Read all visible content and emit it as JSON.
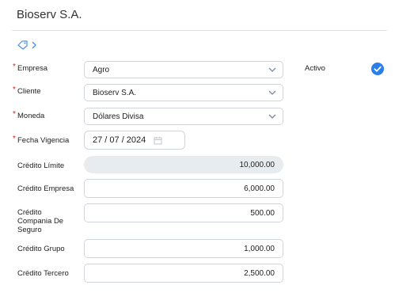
{
  "header": {
    "title": "Bioserv S.A."
  },
  "form": {
    "empresa": {
      "label": "Empresa",
      "value": "Agro"
    },
    "cliente": {
      "label": "Cliente",
      "value": "Bioserv S.A."
    },
    "moneda": {
      "label": "Moneda",
      "value": "Dólares Divisa"
    },
    "fecha": {
      "label": "Fecha Vigencia",
      "value": "27 / 07 / 2024"
    },
    "credito_limite": {
      "label": "Crédito Límite",
      "value": "10,000.00"
    },
    "credito_empresa": {
      "label": "Crédito Empresa",
      "value": "6,000.00"
    },
    "credito_seguro": {
      "label": "Crédito Compania De Seguro",
      "value": "500.00"
    },
    "credito_grupo": {
      "label": "Crédito Grupo",
      "value": "1,000.00"
    },
    "credito_tercero": {
      "label": "Crédito Tercero",
      "value": "2,500.00"
    },
    "activo": {
      "label": "Activo",
      "checked": true
    }
  },
  "required_marker": "*",
  "colors": {
    "accent": "#2b7de9",
    "required": "#e02020",
    "readonly_bg": "#e9ecef"
  },
  "icons": [
    "tag-icon",
    "chevron-right-icon",
    "chevron-down-icon",
    "calendar-icon",
    "checkmark-icon"
  ]
}
